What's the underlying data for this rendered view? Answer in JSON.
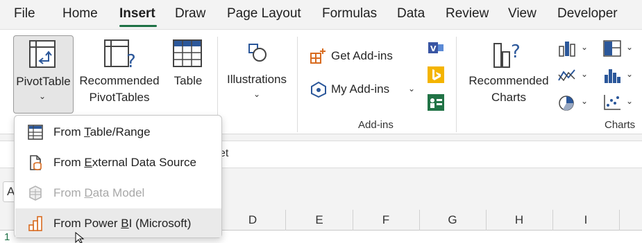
{
  "menu_tabs": [
    "File",
    "Home",
    "Insert",
    "Draw",
    "Page Layout",
    "Formulas",
    "Data",
    "Review",
    "View",
    "Developer"
  ],
  "ribbon": {
    "pivottable": "PivotTable",
    "recommended_pivot_1": "Recommended",
    "recommended_pivot_2": "PivotTables",
    "table": "Table",
    "illustrations": "Illustrations",
    "get_addins": "Get Add-ins",
    "my_addins": "My Add-ins",
    "addins_group": "Add-ins",
    "recommended_charts_1": "Recommended",
    "recommended_charts_2": "Charts",
    "charts_group": "Charts"
  },
  "formula_bar": {
    "partial_text": "et",
    "namebox_text": "A"
  },
  "dropdown": {
    "items": [
      {
        "pre": "From ",
        "key": "T",
        "post": "able/Range",
        "icon": "table-range-icon",
        "enabled": true
      },
      {
        "pre": "From ",
        "key": "E",
        "post": "xternal Data Source",
        "icon": "external-data-icon",
        "enabled": true
      },
      {
        "pre": "From ",
        "key": "D",
        "post": "ata Model",
        "icon": "data-model-icon",
        "enabled": false
      },
      {
        "pre": "From Power ",
        "key": "B",
        "post": "I (Microsoft)",
        "icon": "power-bi-icon",
        "enabled": true,
        "hover": true
      }
    ]
  },
  "columns": [
    "D",
    "E",
    "F",
    "G",
    "H",
    "I"
  ],
  "row_number": "1",
  "colors": {
    "accent": "#1e7145",
    "icon_blue": "#2b579a",
    "icon_orange": "#d86b1f",
    "bing": "#f4b400",
    "teams_green": "#217346"
  }
}
